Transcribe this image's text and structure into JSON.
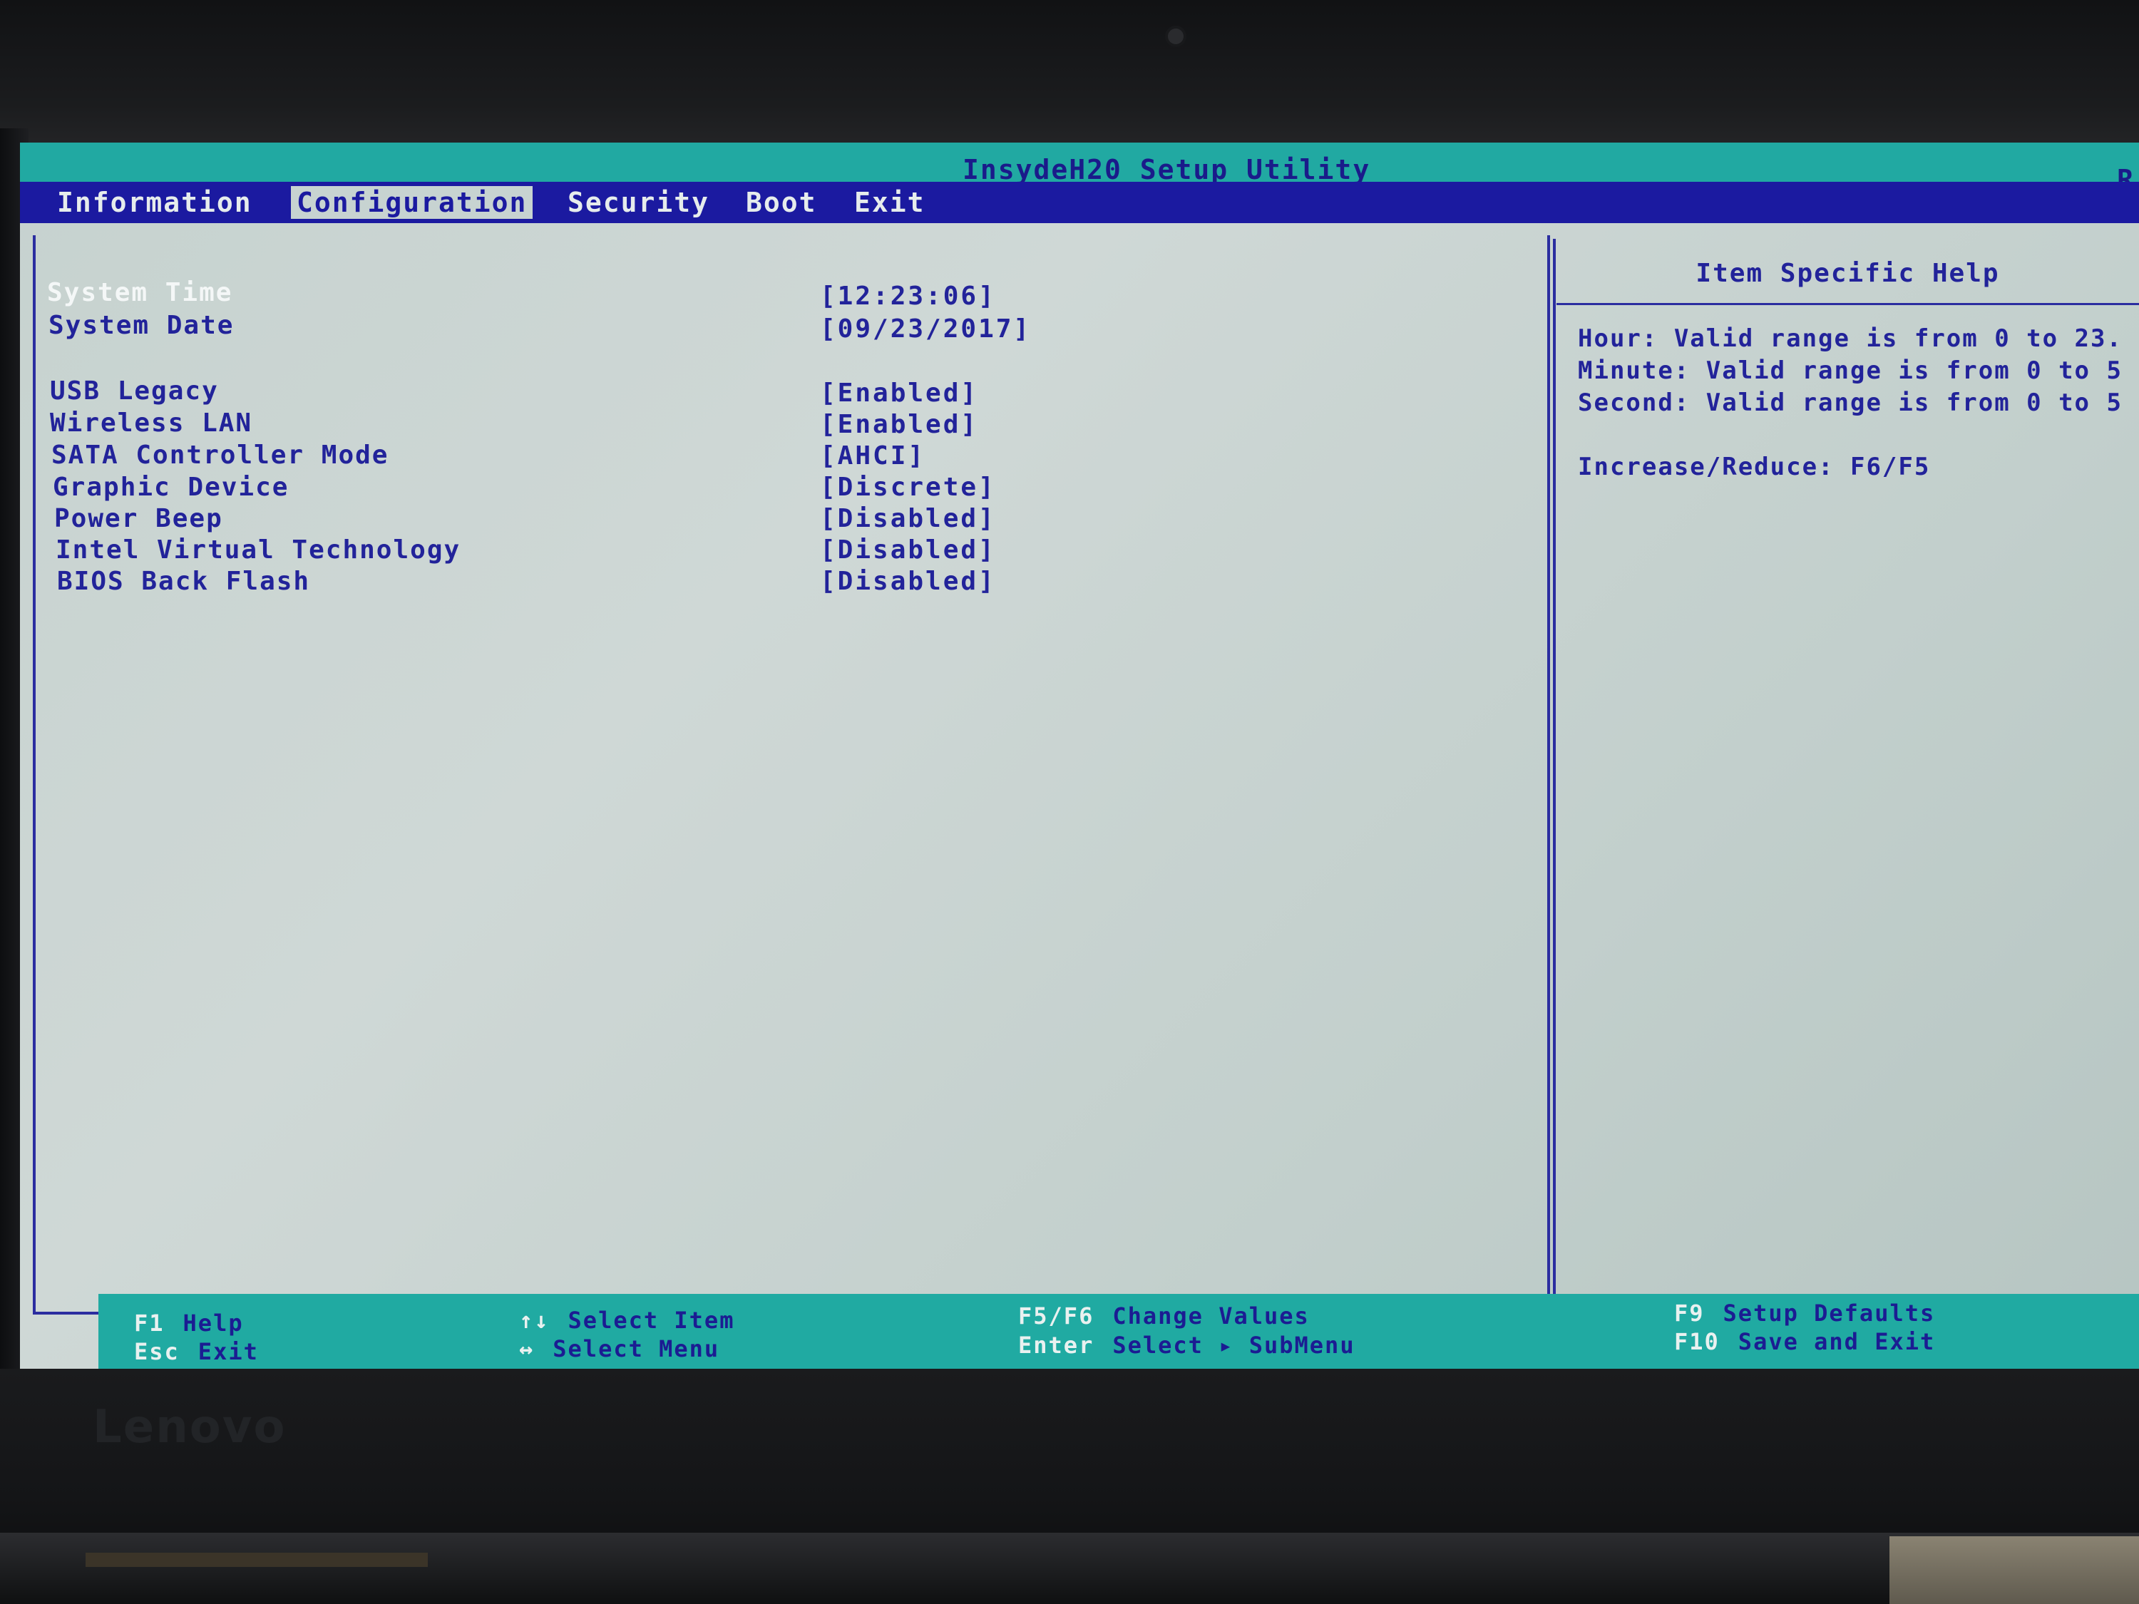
{
  "window": {
    "title": "InsydeH20 Setup Utility",
    "title_right_char": "R"
  },
  "menu": {
    "tabs": [
      "Information",
      "Configuration",
      "Security",
      "Boot",
      "Exit"
    ],
    "active_tab": "Configuration"
  },
  "settings": [
    {
      "label": "System Time",
      "value": "[12:23:06]",
      "selected": true
    },
    {
      "label": "System Date",
      "value": "[09/23/2017]",
      "selected": false
    },
    {
      "label": "USB Legacy",
      "value": "[Enabled]",
      "selected": false
    },
    {
      "label": "Wireless LAN",
      "value": "[Enabled]",
      "selected": false
    },
    {
      "label": "SATA Controller Mode",
      "value": "[AHCI]",
      "selected": false
    },
    {
      "label": "Graphic Device",
      "value": "[Discrete]",
      "selected": false
    },
    {
      "label": "Power Beep",
      "value": "[Disabled]",
      "selected": false
    },
    {
      "label": "Intel Virtual Technology",
      "value": "[Disabled]",
      "selected": false
    },
    {
      "label": "BIOS Back Flash",
      "value": "[Disabled]",
      "selected": false
    }
  ],
  "help": {
    "title": "Item Specific Help",
    "lines": [
      "Hour: Valid range is from 0 to 23.",
      "Minute: Valid range is from 0 to 5",
      "Second: Valid range is from 0 to 5",
      "Increase/Reduce: F6/F5"
    ]
  },
  "footer": {
    "keys": [
      {
        "key": "F1",
        "desc": "Help"
      },
      {
        "key": "Esc",
        "desc": "Exit"
      },
      {
        "key": "↑↓",
        "desc": "Select Item"
      },
      {
        "key": "↔",
        "desc": "Select Menu"
      },
      {
        "key": "F5/F6",
        "desc": "Change Values"
      },
      {
        "key": "Enter",
        "desc": "Select ▸ SubMenu"
      },
      {
        "key": "F9",
        "desc": "Setup Defaults"
      },
      {
        "key": "F10",
        "desc": "Save and Exit"
      }
    ]
  },
  "bezel": {
    "logo": "Lenovo"
  },
  "colors": {
    "screen_bg": "#c6d2cf",
    "title_bar": "#21a9a2",
    "menu_bar": "#1b1aa0",
    "text_blue": "#22239a",
    "selected_text": "#f4f7f7"
  }
}
